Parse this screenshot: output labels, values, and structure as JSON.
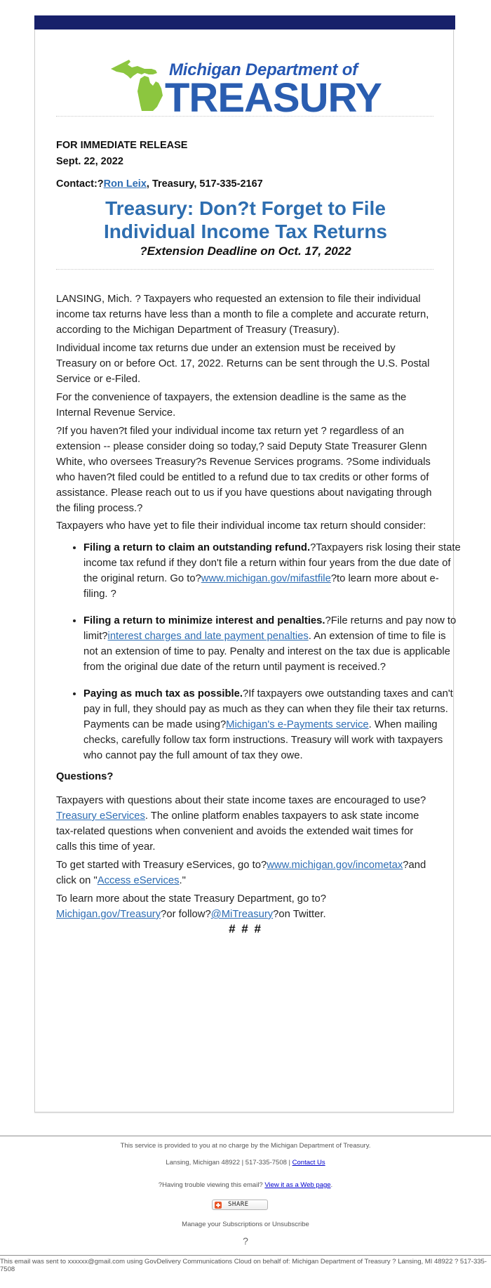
{
  "header": {
    "logo_line1": "Michigan Department of",
    "logo_line2": "TREASURY",
    "brand_bar_color": "#17206a",
    "logo_green": "#8cc63f",
    "logo_blue": "#2a5db0"
  },
  "release": {
    "label": "FOR IMMEDIATE RELEASE",
    "date": "Sept. 22, 2022",
    "contact_prefix": "Contact:?",
    "contact_name": "Ron Leix",
    "contact_suffix": ", Treasury, 517-335-2167"
  },
  "headline": {
    "line1": "Treasury: Don?t Forget to File",
    "line2": "Individual Income Tax Returns",
    "subhead": "?Extension Deadline on Oct. 17, 2022"
  },
  "body": {
    "p1": "LANSING, Mich. ? Taxpayers who requested an extension to file their individual income tax returns have less than a month to file a complete and accurate return, according to the Michigan Department of Treasury (Treasury).",
    "p2": "Individual income tax returns due under an extension must be received by Treasury on or before Oct. 17, 2022. Returns can be sent through the U.S. Postal Service or e-Filed.",
    "p3": "For the convenience of taxpayers, the extension deadline is the same as the Internal Revenue Service.",
    "p4": "?If you haven?t filed your individual income tax return yet ? regardless of an extension -- please consider doing so today,? said Deputy State Treasurer Glenn White, who oversees Treasury?s Revenue Services programs. ?Some individuals who haven?t filed could be entitled to a refund due to tax credits or other forms of assistance. Please reach out to us if you have questions about navigating through the filing process.?",
    "p5": "Taxpayers who have yet to file their individual income tax return should consider:",
    "bullets": [
      {
        "title": "Filing a return to claim an outstanding refund.",
        "text_before": "?Taxpayers risk losing their state income tax refund if they don't file a return within four years from the due date of the original return. Go to?",
        "link": "www.michigan.gov/mifastfile",
        "text_after": "?to learn more about e-filing. ?"
      },
      {
        "title": "Filing a return to minimize interest and penalties.",
        "text_before": "?File returns and pay now to limit?",
        "link": "interest charges and late payment penalties",
        "text_after": ". An extension of time to file is not an extension of time to pay. Penalty and interest on the tax due is applicable from the original due date of the return until payment is received.?"
      },
      {
        "title": "Paying as much tax as possible.",
        "text_before": "?If taxpayers owe outstanding taxes and can't pay in full, they should pay as much as they can when they file their tax returns. Payments can be made using?",
        "link": "Michigan's e-Payments service",
        "text_after": ". When mailing checks, carefully follow tax form instructions. Treasury will work with taxpayers who cannot pay the full amount of tax they owe."
      }
    ],
    "questions_heading": "Questions?",
    "q1_before": "Taxpayers with questions about their state income taxes are encouraged to use?",
    "q1_link": "Treasury eServices",
    "q1_after": ". The online platform enables taxpayers to ask state income tax-related questions when convenient and avoids the extended wait times for calls this time of year.",
    "q2_before": "To get started with Treasury eServices, go to?",
    "q2_link1": "www.michigan.gov/incometax",
    "q2_mid": "?and click on \"",
    "q2_link2": "Access eServices",
    "q2_after": ".\"",
    "q3_before": "To learn more about the state Treasury Department, go to?",
    "q3_link1": "Michigan.gov/Treasury",
    "q3_mid": "?or follow?",
    "q3_link2": "@MiTreasury",
    "q3_after": "?on Twitter.",
    "end_mark": "# # #"
  },
  "footer": {
    "service_note": "This service is provided to you at no charge by the Michigan Department of Treasury.",
    "address": "Lansing, Michigan 48922 | 517-335-7508 | ",
    "contact_link": "Contact Us",
    "trouble_text": "?Having trouble viewing this email? ",
    "web_link": "View it as a Web page",
    "trouble_after": ".",
    "share_label": "SHARE",
    "manage": "Manage your Subscriptions or Unsubscribe",
    "placeholder_char": "?",
    "sent_to": "This email was sent to xxxxxx@gmail.com using GovDelivery Communications Cloud on behalf of: Michigan Department of Treasury ? Lansing, MI 48922 ? 517-335-7508"
  }
}
